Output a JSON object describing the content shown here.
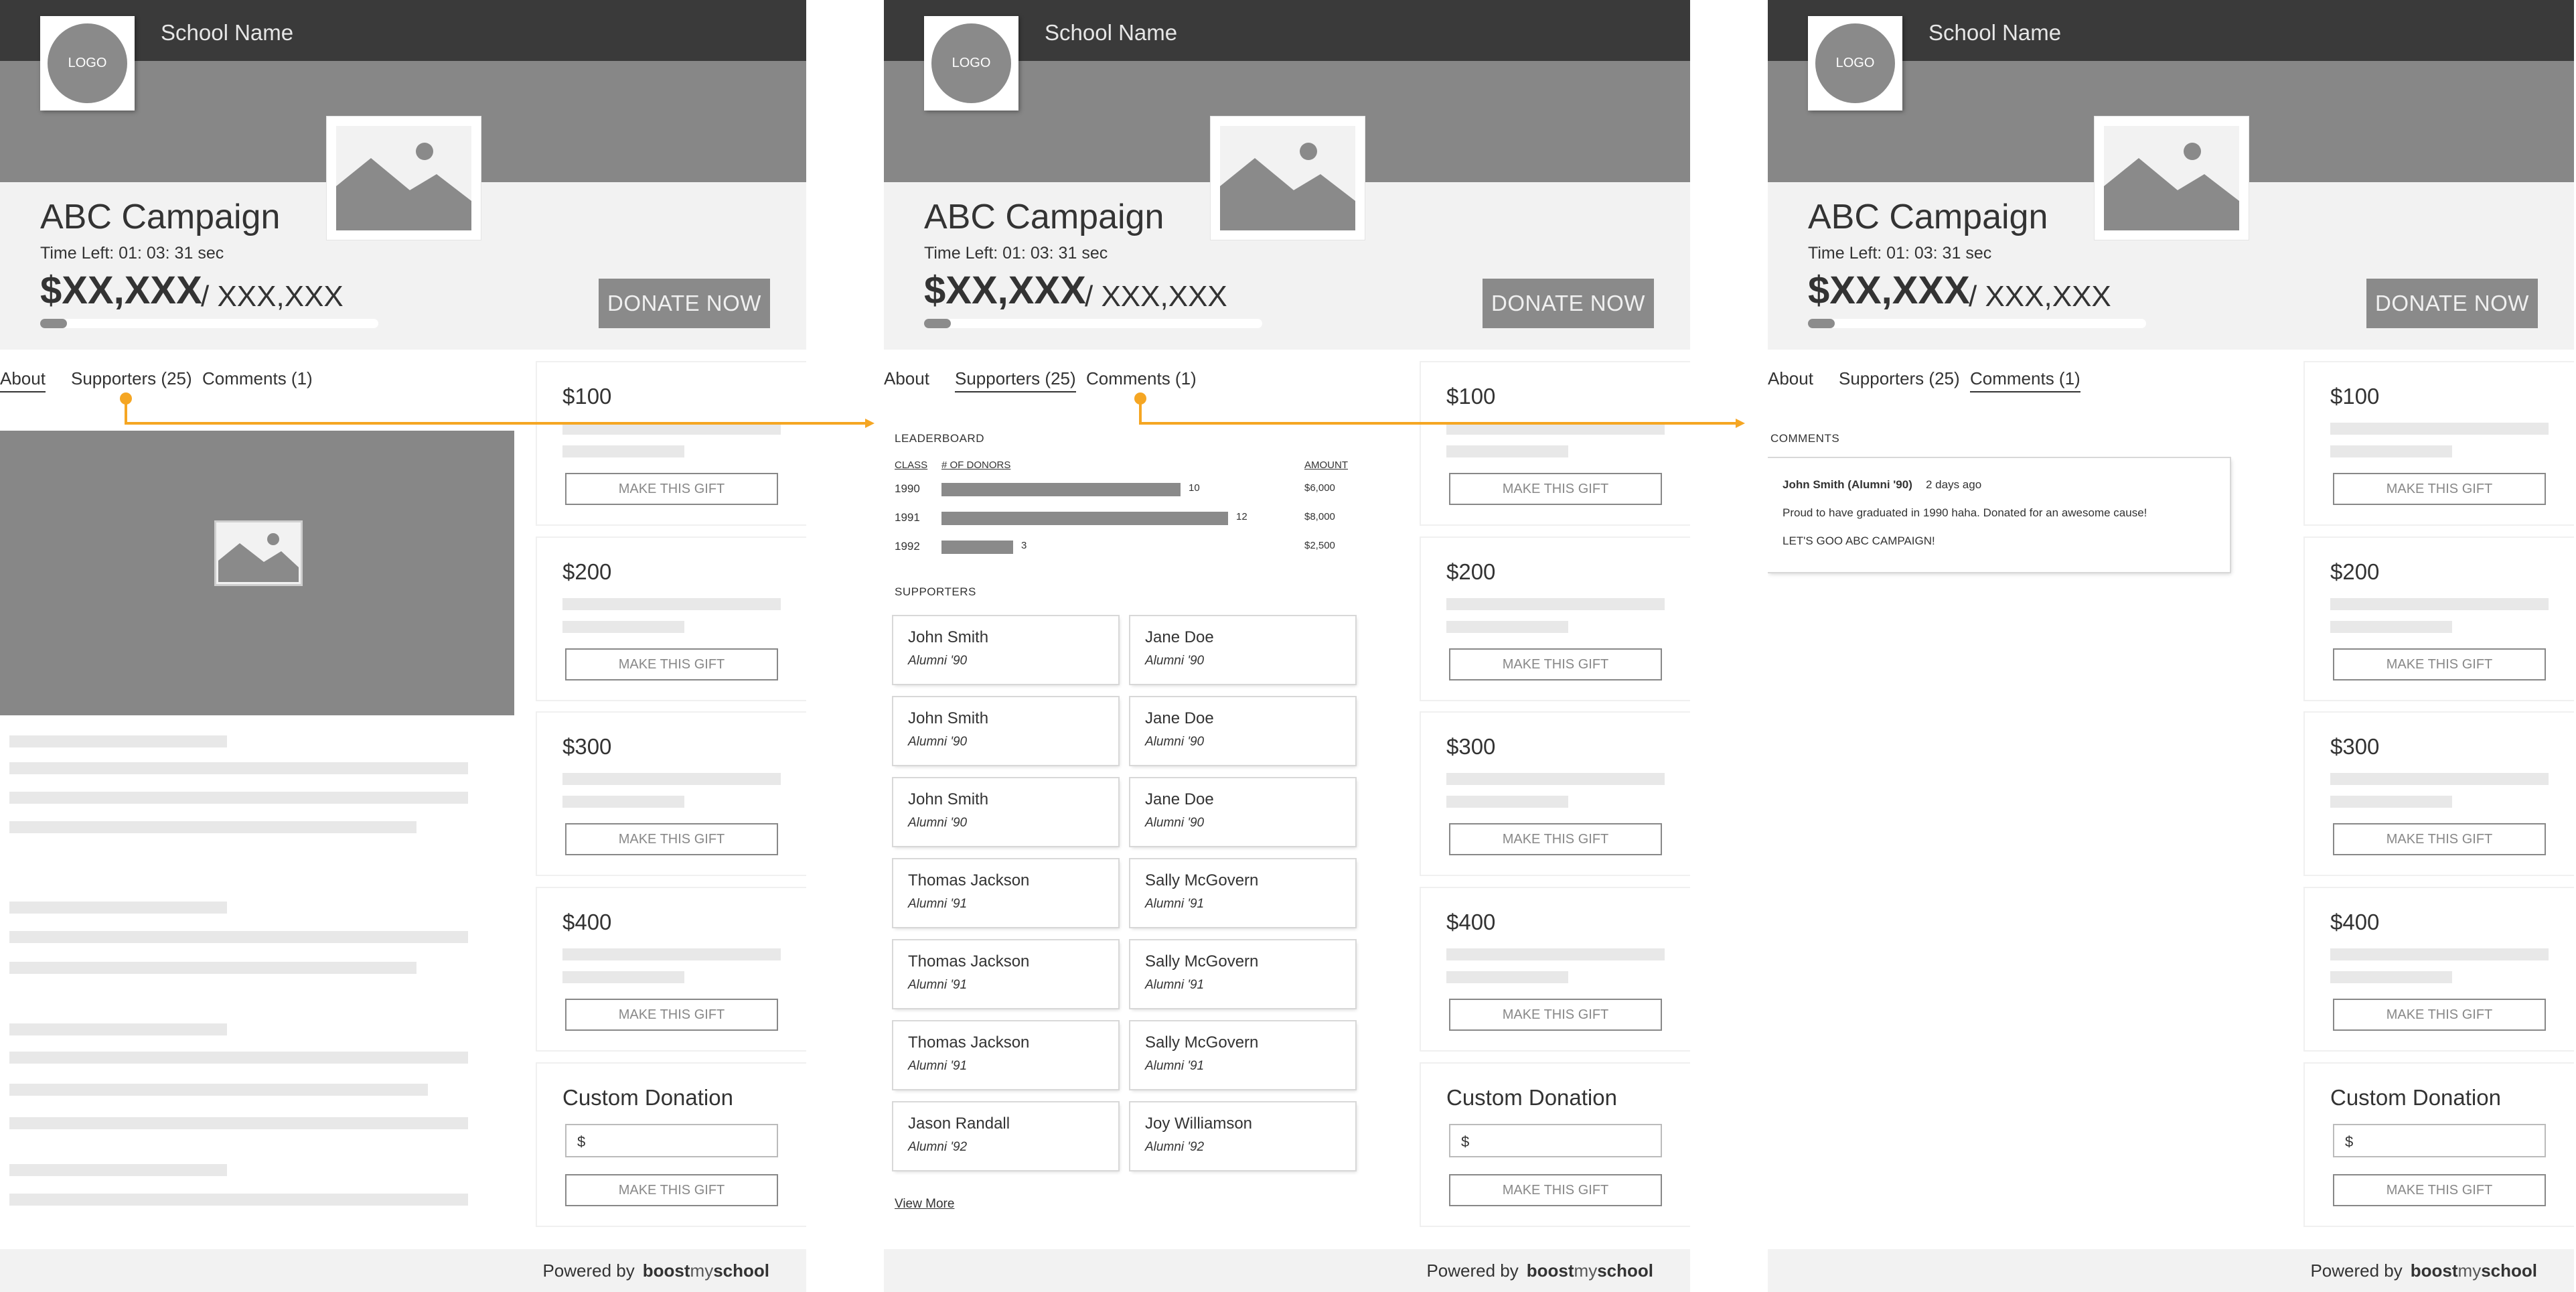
{
  "school_name": "School Name",
  "logo_text": "LOGO",
  "campaign": {
    "title": "ABC Campaign",
    "time_left": "Time Left: 01: 03: 31 sec",
    "raised": "$XX,XXX",
    "goal": "/ XXX,XXX",
    "progress_fraction": 0.08,
    "donate_label": "DONATE NOW"
  },
  "tabs": {
    "about": "About",
    "supporters": "Supporters (25)",
    "comments": "Comments (1)"
  },
  "gifts": [
    {
      "amount": "$100",
      "button": "MAKE THIS GIFT"
    },
    {
      "amount": "$200",
      "button": "MAKE THIS GIFT"
    },
    {
      "amount": "$300",
      "button": "MAKE THIS GIFT"
    },
    {
      "amount": "$400",
      "button": "MAKE THIS GIFT"
    }
  ],
  "custom_donation": {
    "title": "Custom Donation",
    "currency": "$",
    "button": "MAKE THIS GIFT"
  },
  "footer": {
    "powered_by": "Powered by",
    "brand_a": "boost",
    "brand_b": "my",
    "brand_c": "school"
  },
  "leaderboard": {
    "title": "LEADERBOARD",
    "col_class": "CLASS",
    "col_donors": "# OF DONORS",
    "col_amount": "AMOUNT",
    "rows": [
      {
        "class": "1990",
        "donors": 10,
        "donors_label": "10",
        "amount": "$6,000"
      },
      {
        "class": "1991",
        "donors": 12,
        "donors_label": "12",
        "amount": "$8,000"
      },
      {
        "class": "1992",
        "donors": 3,
        "donors_label": "3",
        "amount": "$2,500"
      }
    ]
  },
  "supporters": {
    "title": "SUPPORTERS",
    "list": [
      {
        "name": "John Smith",
        "class": "Alumni '90"
      },
      {
        "name": "Jane Doe",
        "class": "Alumni '90"
      },
      {
        "name": "John Smith",
        "class": "Alumni '90"
      },
      {
        "name": "Jane Doe",
        "class": "Alumni '90"
      },
      {
        "name": "John Smith",
        "class": "Alumni '90"
      },
      {
        "name": "Jane Doe",
        "class": "Alumni '90"
      },
      {
        "name": "Thomas Jackson",
        "class": "Alumni '91"
      },
      {
        "name": "Sally McGovern",
        "class": "Alumni '91"
      },
      {
        "name": "Thomas Jackson",
        "class": "Alumni '91"
      },
      {
        "name": "Sally McGovern",
        "class": "Alumni '91"
      },
      {
        "name": "Thomas Jackson",
        "class": "Alumni '91"
      },
      {
        "name": "Sally McGovern",
        "class": "Alumni '91"
      },
      {
        "name": "Jason Randall",
        "class": "Alumni '92"
      },
      {
        "name": "Joy Williamson",
        "class": "Alumni '92"
      }
    ],
    "view_more": "View More"
  },
  "comments": {
    "title": "COMMENTS",
    "items": [
      {
        "author": "John Smith (Alumni '90)",
        "time": "2 days ago",
        "line1": "Proud to have graduated in 1990 haha. Donated for an awesome cause!",
        "line2": "LET'S GOO ABC CAMPAIGN!"
      }
    ]
  },
  "colors": {
    "topbar": "#3a3a3a",
    "banner": "#878787",
    "connector": "#f5a623"
  }
}
